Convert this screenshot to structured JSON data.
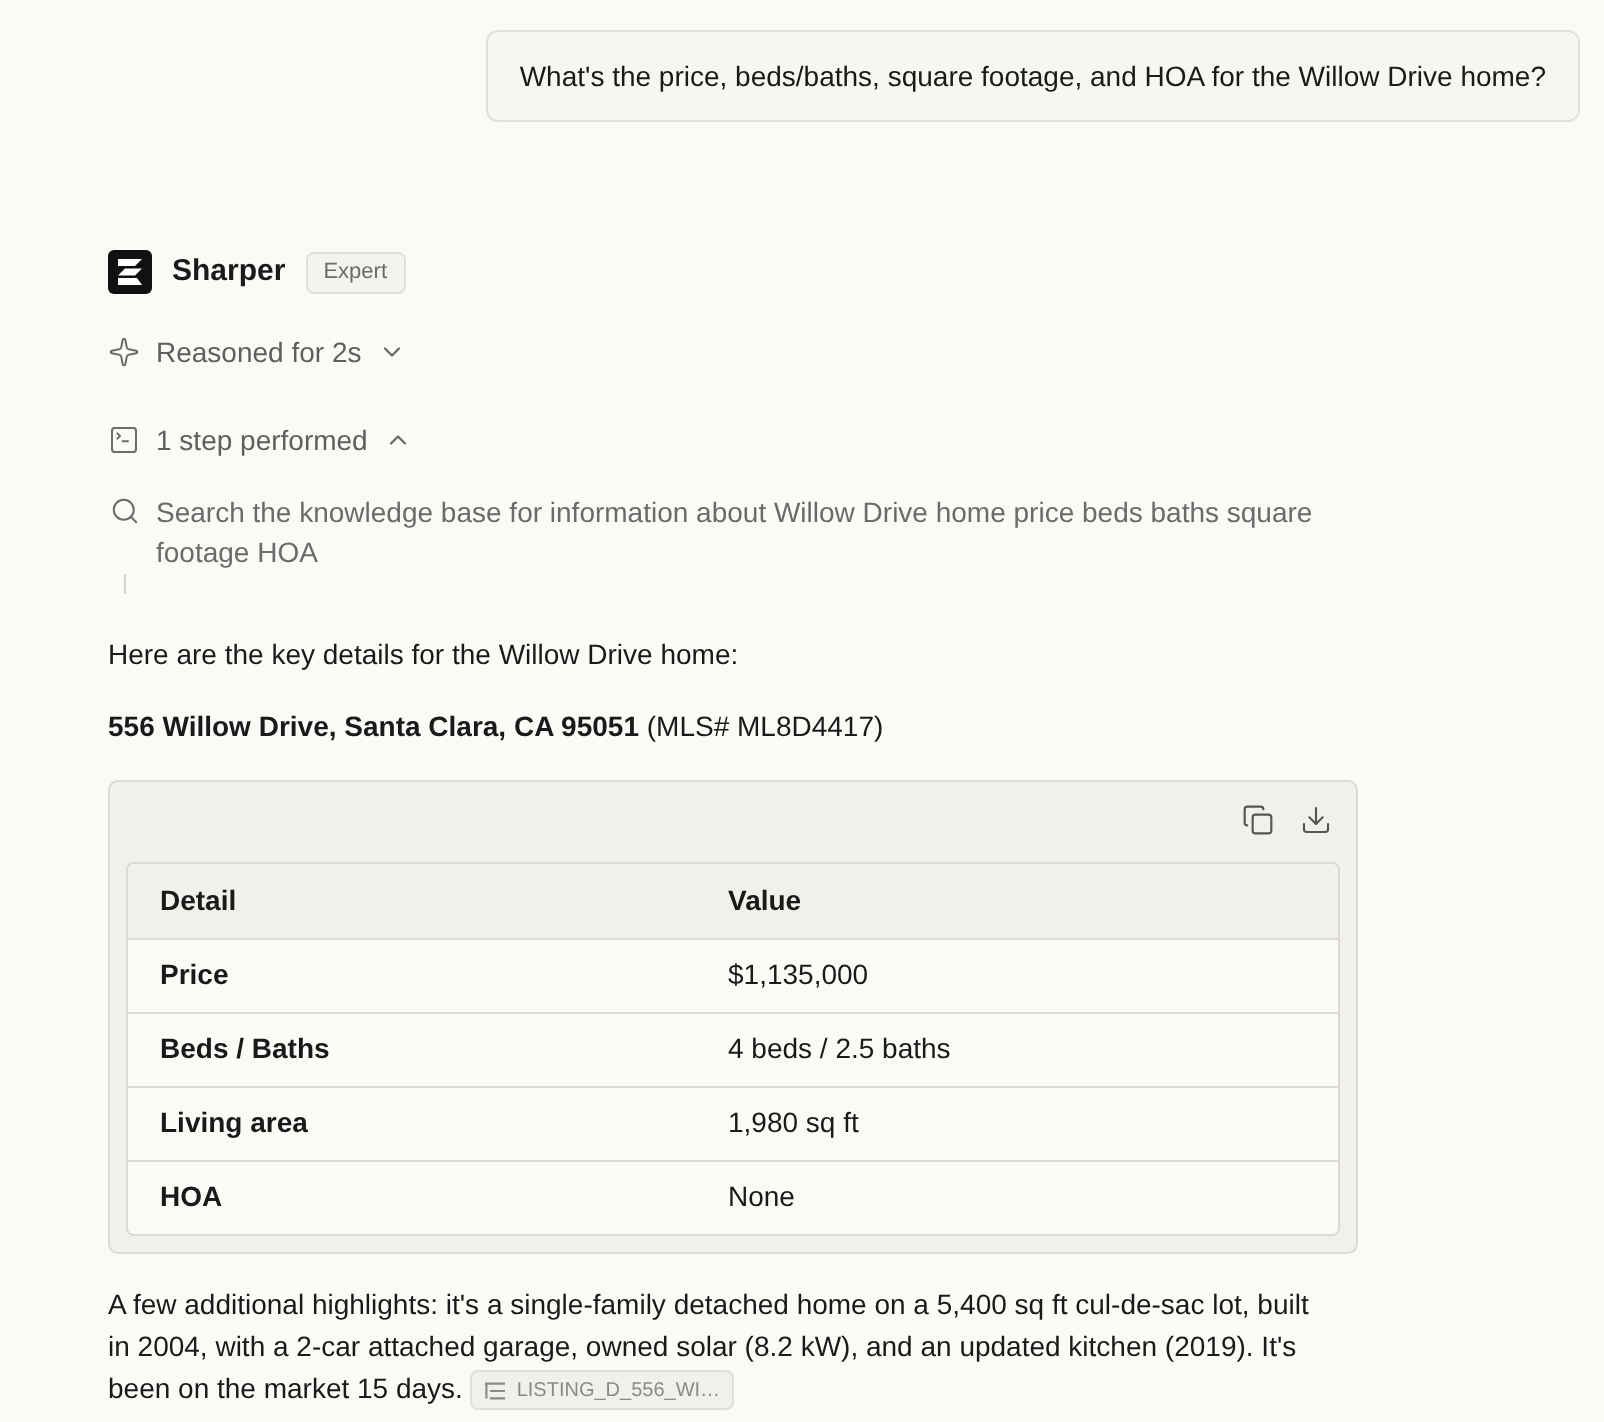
{
  "user_message": {
    "text": "What's the price, beds/baths, square footage, and HOA for the Willow Drive home?"
  },
  "assistant": {
    "name": "Sharper",
    "badge": "Expert"
  },
  "reasoning": {
    "label": "Reasoned for 2s",
    "expanded": false
  },
  "steps": {
    "label": "1 step performed",
    "expanded": true,
    "items": [
      {
        "kind": "search",
        "text": "Search the knowledge base for information about Willow Drive home price beds baths square footage HOA"
      }
    ]
  },
  "intro": "Here are the key details for the Willow Drive home:",
  "address": "**556 Willow Drive, Santa Clara, CA 95051** (MLS# ML8D4417)",
  "table": {
    "columns": [
      "Detail",
      "Value"
    ],
    "rows": [
      [
        "Price",
        "$1,135,000"
      ],
      [
        "Beds / Baths",
        "4 beds / 2.5 baths"
      ],
      [
        "Living area",
        "1,980 sq ft"
      ],
      [
        "HOA",
        "None"
      ]
    ]
  },
  "highlights": {
    "text": "A few additional highlights: it's a single-family detached home on a 5,400 sq ft cul-de-sac lot, built in 2004, with a 2-car attached garage, owned solar (8.2 kW), and an updated kitchen (2019). It's been on the market 15 days.",
    "citation": "LISTING_D_556_WI…"
  }
}
